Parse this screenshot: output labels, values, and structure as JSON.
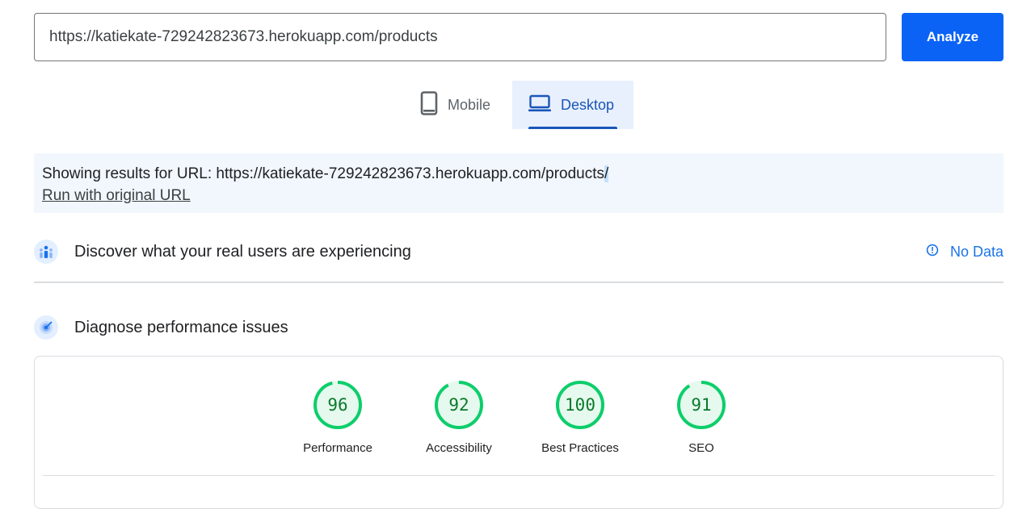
{
  "search": {
    "value": "https://katiekate-729242823673.herokuapp.com/products",
    "placeholder": "Enter a web page URL"
  },
  "analyze_label": "Analyze",
  "tabs": [
    {
      "label": "Mobile",
      "icon": "phone-icon",
      "selected": false
    },
    {
      "label": "Desktop",
      "icon": "laptop-icon",
      "selected": true
    }
  ],
  "notice": {
    "prefix": "Showing results for URL: https://katiekate-729242823673.herokuapp.com/products",
    "suffix": "/",
    "link": "Run with original URL"
  },
  "field_data": {
    "title": "Discover what your real users are experiencing",
    "status": "No Data",
    "icon": "info-icon"
  },
  "lab_data": {
    "title": "Diagnose performance issues"
  },
  "scores": [
    {
      "value": 96,
      "label": "Performance"
    },
    {
      "value": 92,
      "label": "Accessibility"
    },
    {
      "value": 100,
      "label": "Best Practices"
    },
    {
      "value": 91,
      "label": "SEO"
    }
  ],
  "colors": {
    "accent": "#1a73e8",
    "good": "#0cce6b",
    "good_text": "#0a7a2a",
    "good_fill": "#e6f9ee"
  }
}
